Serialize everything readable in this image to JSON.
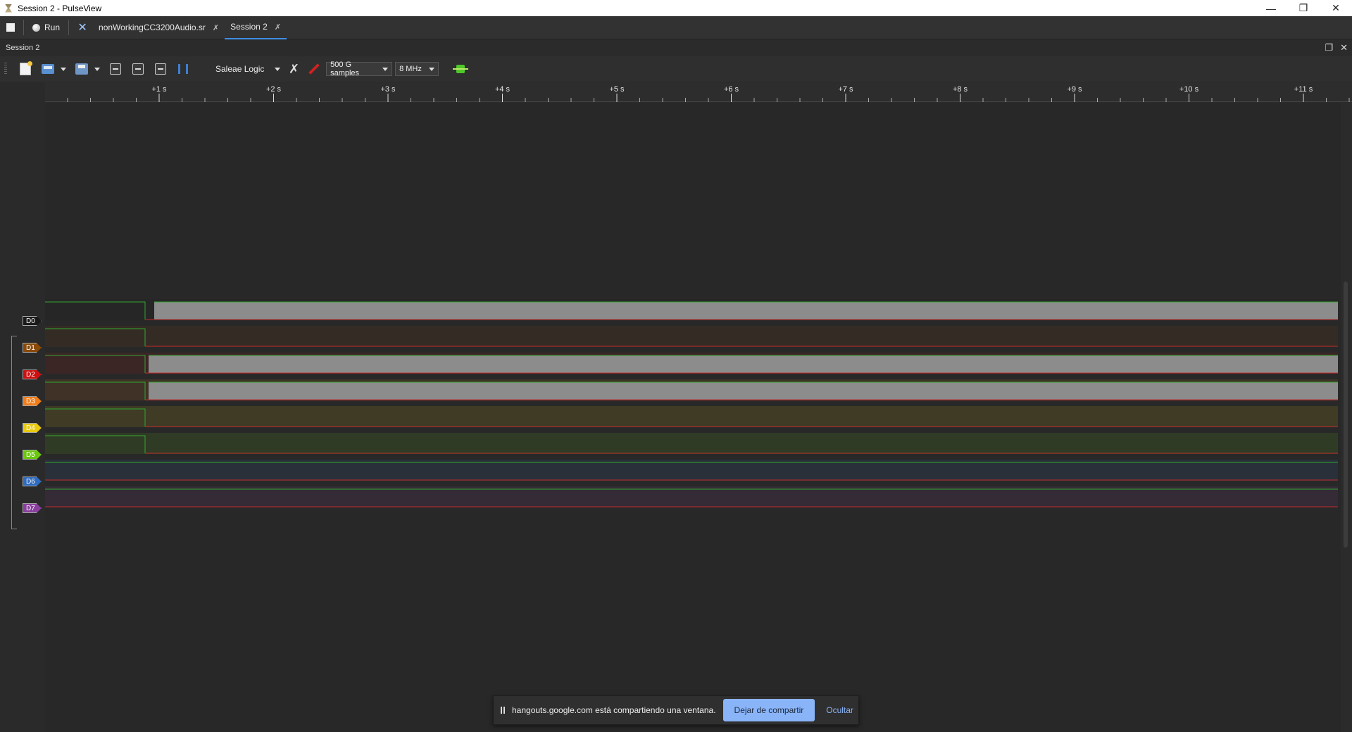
{
  "window": {
    "title": "Session 2 - PulseView",
    "controls": {
      "minimize": "—",
      "restore": "❐",
      "close": "✕"
    }
  },
  "tabrow": {
    "run_label": "Run",
    "tabs": [
      {
        "label": "nonWorkingCC3200Audio.sr",
        "pin": "✗"
      },
      {
        "label": "Session 2",
        "pin": "✗",
        "active": true
      }
    ]
  },
  "session": {
    "title": "Session 2",
    "float_icon": "❐",
    "close_icon": "✕"
  },
  "toolbar": {
    "device": "Saleae Logic",
    "samples": "500 G samples",
    "samplerate": "8 MHz"
  },
  "ruler": {
    "ticks": [
      "+1 s",
      "+2 s",
      "+3 s",
      "+4 s",
      "+5 s",
      "+6 s",
      "+7 s",
      "+8 s",
      "+9 s",
      "+10 s",
      "+11 s"
    ]
  },
  "channels": [
    {
      "name": "D0",
      "color": "#1a1a1a"
    },
    {
      "name": "D1",
      "color": "#8a4a05"
    },
    {
      "name": "D2",
      "color": "#cc1010"
    },
    {
      "name": "D3",
      "color": "#f07d1a"
    },
    {
      "name": "D4",
      "color": "#eac80e"
    },
    {
      "name": "D5",
      "color": "#6ac70e"
    },
    {
      "name": "D6",
      "color": "#2f6bbf"
    },
    {
      "name": "D7",
      "color": "#8a3f9e"
    }
  ],
  "share": {
    "message": "hangouts.google.com está compartiendo una ventana.",
    "stop_label": "Dejar de compartir",
    "hide_label": "Ocultar"
  },
  "colors": {
    "high_line": "#2fa82f",
    "low_line": "#c02a2a",
    "activity": "#8c8c8c"
  }
}
